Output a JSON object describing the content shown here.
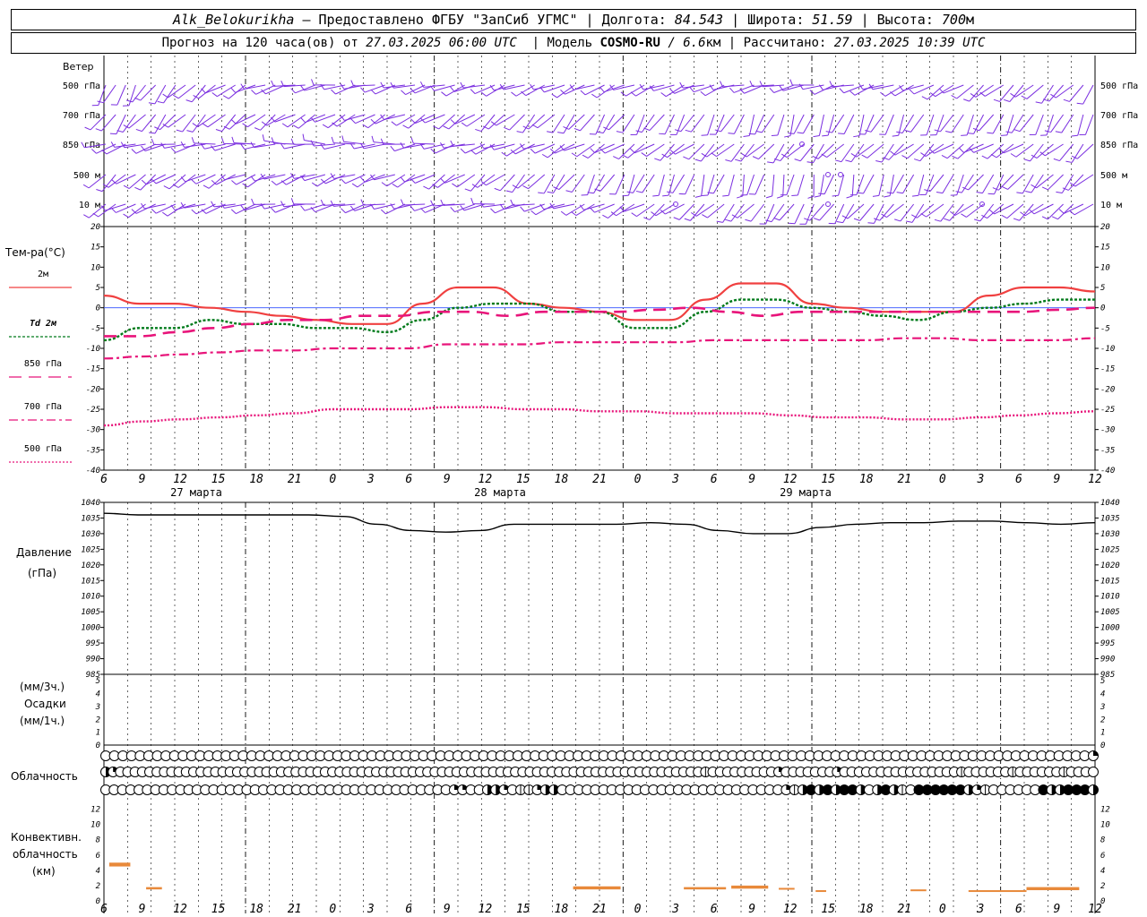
{
  "header": {
    "station": "Alk_Belokurikha",
    "provider": " – Предоставлено ФГБУ \"ЗапСиб УГМС\" ",
    "lon_label": "| Долгота: ",
    "lon_value": "84.543",
    "lat_label": " | Широта: ",
    "lat_value": "51.59",
    "alt_label": " | Высота: ",
    "alt_value": "700",
    "alt_unit": "м",
    "forecast_label": "Прогноз на 120 часа(ов) от ",
    "forecast_start": "27.03.2025 06:00 UTC",
    "model_label": "  | Модель ",
    "model_name": "COSMO-RU",
    "model_res": " / 6.6",
    "model_res_unit": "км",
    "calc_label": " | Рассчитано: ",
    "calc_time": "27.03.2025 10:39 UTC"
  },
  "colors": {
    "wind": "#7a2ee0",
    "t2m": "#f04040",
    "td2m": "#007a1a",
    "t850": "#e8147a",
    "t700": "#e8147a",
    "t500": "#e8147a",
    "zero_line": "#3050ff",
    "pressure": "#000000",
    "convective": "#e8893a"
  },
  "wind_panel": {
    "title": "Ветер",
    "levels": [
      "500 гПа",
      "700 гПа",
      "850 гПа",
      "500 м",
      "10  м"
    ]
  },
  "temp_panel": {
    "title": "Тем-ра(°C)",
    "legend": [
      {
        "key": "t2m",
        "label": "2м"
      },
      {
        "key": "td2m",
        "label": "Td  2м"
      },
      {
        "key": "t850",
        "label": "850 гПа"
      },
      {
        "key": "t700",
        "label": "700 гПа"
      },
      {
        "key": "t500",
        "label": "500 гПа"
      }
    ],
    "ticks": [
      "20",
      "15",
      "10",
      "5",
      "0",
      "-5",
      "-10",
      "-15",
      "-20",
      "-25",
      "-30",
      "-35",
      "-40"
    ]
  },
  "pressure_panel": {
    "title": "Давление",
    "unit": "(гПа)",
    "ticks": [
      "1040",
      "1035",
      "1030",
      "1025",
      "1020",
      "1015",
      "1010",
      "1005",
      "1000",
      "995",
      "990",
      "985"
    ]
  },
  "precip_panel": {
    "unit_top": "(мм/3ч.)",
    "title": "Осадки",
    "unit_bottom": "(мм/1ч.)",
    "ticks": [
      "5",
      "4",
      "3",
      "2",
      "1",
      "0"
    ]
  },
  "cloud_panel": {
    "title": "Облачность"
  },
  "conv_panel": {
    "title_line1": "Конвективн.",
    "title_line2": "облачность",
    "unit": "(км)",
    "ticks": [
      "12",
      "10",
      "8",
      "6",
      "4",
      "2",
      "0"
    ]
  },
  "x_axis": {
    "hour_labels": [
      "6",
      "9",
      "12",
      "15",
      "18",
      "21",
      "0",
      "3",
      "6",
      "9",
      "12",
      "15",
      "18",
      "21",
      "0",
      "3",
      "6",
      "9",
      "12",
      "15",
      "18",
      "21",
      "0",
      "3",
      "6",
      "9",
      "12"
    ],
    "day_labels": [
      "27 марта",
      "28 марта",
      "29 марта"
    ]
  },
  "chart_data": [
    {
      "type": "line",
      "title": "Тем-ра(°C)",
      "ylim": [
        -40,
        20
      ],
      "x_hours": [
        0,
        3,
        6,
        9,
        12,
        15,
        18,
        21,
        24,
        27,
        30,
        33,
        36,
        39,
        42,
        45,
        48,
        51,
        54,
        57,
        60,
        63,
        66,
        69,
        72,
        75,
        78
      ],
      "series": [
        {
          "name": "2м",
          "key": "t2m",
          "values": [
            3,
            1,
            1,
            0,
            -1,
            -2,
            -3,
            -4,
            -4,
            1,
            5,
            5,
            1,
            0,
            -1,
            -3,
            -3,
            2,
            6,
            6,
            1,
            0,
            -1,
            -1,
            -1,
            3,
            5,
            5,
            4
          ]
        },
        {
          "name": "Td  2м",
          "key": "td2m",
          "values": [
            -8,
            -5,
            -5,
            -3,
            -4,
            -4,
            -5,
            -5,
            -6,
            -3,
            0,
            1,
            1,
            -1,
            -1,
            -5,
            -5,
            -1,
            2,
            2,
            0,
            -1,
            -2,
            -3,
            -1,
            0,
            1,
            2,
            2
          ]
        },
        {
          "name": "850 гПа",
          "key": "t850",
          "values": [
            -7,
            -7,
            -6,
            -5,
            -4,
            -3,
            -3,
            -2,
            -2,
            -1,
            -1,
            -2,
            -1,
            -1,
            -1,
            -0.5,
            0,
            -1,
            -2,
            -1,
            -1,
            -1,
            -1,
            -1,
            -1,
            -1,
            -0.5,
            0
          ]
        },
        {
          "name": "700 гПа",
          "key": "t700",
          "values": [
            -12.5,
            -12,
            -11.5,
            -11,
            -10.5,
            -10.5,
            -10,
            -10,
            -10,
            -9,
            -9,
            -9,
            -8.5,
            -8.5,
            -8.5,
            -8.5,
            -8,
            -8,
            -8,
            -8,
            -8,
            -7.5,
            -7.5,
            -8,
            -8,
            -8,
            -7.5
          ]
        },
        {
          "name": "500 гПа",
          "key": "t500",
          "values": [
            -29,
            -28,
            -27.5,
            -27,
            -26.5,
            -26,
            -25,
            -25,
            -25,
            -24.5,
            -24.5,
            -25,
            -25,
            -25.5,
            -25.5,
            -26,
            -26,
            -26,
            -26.5,
            -27,
            -27,
            -27.5,
            -27.5,
            -27,
            -26.5,
            -26,
            -25.5
          ]
        }
      ]
    },
    {
      "type": "line",
      "title": "Давление",
      "ylim": [
        985,
        1040
      ],
      "series": [
        {
          "name": "Давление",
          "key": "pressure",
          "values": [
            1036.5,
            1036,
            1036,
            1036,
            1036,
            1036,
            1036,
            1035.5,
            1033,
            1031,
            1030.5,
            1031,
            1033,
            1033,
            1033,
            1033,
            1033.5,
            1033,
            1031,
            1030,
            1030,
            1032,
            1033,
            1033.5,
            1033.5,
            1034,
            1034,
            1033.5,
            1033,
            1033.5
          ]
        }
      ]
    },
    {
      "type": "bar",
      "title": "Осадки",
      "ylim": [
        0,
        5
      ],
      "values": []
    },
    {
      "type": "bar",
      "title": "Конвективн. облачность",
      "ylim": [
        0,
        13
      ],
      "segments": [
        {
          "start_h": 1,
          "end_h": 5,
          "base_km": 4.5,
          "top_km": 5
        },
        {
          "start_h": 8,
          "end_h": 11,
          "base_km": 1.5,
          "top_km": 1.8
        },
        {
          "start_h": 89,
          "end_h": 98,
          "base_km": 1.5,
          "top_km": 1.9
        },
        {
          "start_h": 110,
          "end_h": 118,
          "base_km": 1.5,
          "top_km": 1.8
        },
        {
          "start_h": 119,
          "end_h": 126,
          "base_km": 1.6,
          "top_km": 2
        },
        {
          "start_h": 128,
          "end_h": 131,
          "base_km": 1.5,
          "top_km": 1.7
        },
        {
          "start_h": 135,
          "end_h": 137,
          "base_km": 1.2,
          "top_km": 1.4
        },
        {
          "start_h": 153,
          "end_h": 156,
          "base_km": 1.3,
          "top_km": 1.5
        },
        {
          "start_h": 164,
          "end_h": 175,
          "base_km": 1.2,
          "top_km": 1.4
        },
        {
          "start_h": 175,
          "end_h": 185,
          "base_km": 1.4,
          "top_km": 1.8
        }
      ]
    }
  ],
  "clouds": {
    "upper": [
      0,
      0,
      0,
      0,
      0,
      0,
      0,
      0,
      0,
      0,
      0,
      0,
      0,
      0,
      0,
      0,
      0,
      0,
      0,
      0,
      0,
      0,
      0,
      0,
      0,
      0,
      0,
      0,
      0,
      0,
      0,
      0,
      0,
      0,
      0,
      0,
      0,
      0,
      0,
      0,
      0,
      0,
      0,
      0,
      0,
      0,
      0,
      0,
      0,
      0,
      0,
      0,
      0,
      0,
      0,
      0,
      0,
      0,
      0,
      0,
      0,
      0,
      0,
      0,
      0,
      0,
      0,
      0,
      0,
      0,
      0,
      0,
      0,
      0,
      0,
      0,
      0,
      0,
      0,
      0,
      0,
      0,
      0,
      0,
      0,
      0,
      0,
      0,
      0,
      0,
      0,
      0,
      0,
      0,
      0,
      0,
      0,
      0,
      0,
      0,
      0,
      0,
      0,
      0,
      0,
      0,
      0,
      0,
      0,
      0,
      0,
      0,
      0,
      0,
      0,
      2
    ],
    "middle": [
      3,
      2,
      0,
      0,
      0,
      0,
      0,
      0,
      0,
      0,
      0,
      0,
      0,
      0,
      0,
      0,
      0,
      0,
      0,
      0,
      0,
      0,
      0,
      0,
      0,
      0,
      0,
      0,
      0,
      0,
      0,
      0,
      0,
      0,
      0,
      0,
      0,
      0,
      0,
      0,
      0,
      0,
      0,
      0,
      0,
      0,
      0,
      0,
      0,
      0,
      0,
      0,
      0,
      0,
      0,
      0,
      0,
      0,
      0,
      0,
      0,
      0,
      0,
      0,
      0,
      0,
      0,
      0,
      0,
      0,
      0,
      0,
      0,
      0,
      0,
      0,
      0,
      0,
      0,
      0,
      0,
      0,
      1,
      0,
      0,
      0,
      0,
      0,
      0,
      0,
      0,
      0,
      2,
      0,
      0,
      0,
      0,
      0,
      0,
      0,
      2,
      0,
      0,
      0,
      0,
      0,
      0,
      0,
      0,
      0,
      0,
      0,
      0,
      0,
      0,
      0,
      0,
      1,
      0,
      0,
      0,
      0,
      0,
      0,
      1,
      0,
      0,
      0,
      0,
      0,
      0,
      1,
      0,
      0,
      0,
      0
    ],
    "lower": [
      0,
      0,
      0,
      0,
      0,
      0,
      0,
      0,
      0,
      0,
      0,
      0,
      0,
      0,
      0,
      0,
      0,
      0,
      0,
      0,
      0,
      0,
      0,
      0,
      0,
      0,
      0,
      0,
      0,
      0,
      0,
      0,
      0,
      0,
      0,
      0,
      0,
      0,
      0,
      0,
      0,
      0,
      2,
      2,
      0,
      0,
      3,
      3,
      2,
      0,
      1,
      1,
      2,
      3,
      3,
      0,
      0,
      0,
      0,
      0,
      0,
      0,
      0,
      0,
      0,
      0,
      0,
      0,
      0,
      0,
      0,
      0,
      0,
      0,
      0,
      0,
      0,
      0,
      0,
      0,
      0,
      0,
      2,
      1,
      3,
      4,
      3,
      4,
      3,
      4,
      4,
      3,
      0,
      3,
      4,
      3,
      1,
      0,
      4,
      4,
      4,
      4,
      4,
      4,
      3,
      2,
      1,
      0,
      0,
      0,
      0,
      0,
      0,
      4,
      3,
      3,
      4,
      4,
      4,
      3
    ]
  },
  "wind": {
    "rows": [
      {
        "dirs": [
          10,
          10,
          10,
          10,
          10,
          10,
          10,
          10,
          10,
          10,
          10,
          10,
          10,
          10,
          10,
          10,
          10,
          10,
          10,
          10,
          10,
          10,
          10,
          10,
          10,
          10,
          10,
          10,
          10,
          10,
          10,
          10,
          10,
          10,
          10,
          10,
          10,
          10,
          10,
          10,
          10,
          10,
          10,
          10,
          10,
          10,
          10,
          10,
          10,
          10,
          10,
          10,
          10,
          10,
          10,
          10,
          10,
          10,
          10,
          10,
          10,
          10,
          10,
          10,
          10,
          10,
          10,
          10,
          10,
          10,
          10,
          10,
          10,
          10,
          10,
          10,
          10,
          10,
          10,
          10,
          10,
          10,
          10,
          10,
          10,
          10,
          10,
          10,
          10,
          10,
          10,
          10,
          10,
          10,
          10,
          10,
          10,
          10,
          10,
          10,
          10,
          10,
          10,
          10,
          10,
          10,
          10,
          10,
          10,
          10,
          10,
          10,
          10,
          10,
          10,
          10,
          10,
          10,
          10,
          10,
          10,
          10,
          10,
          10,
          10,
          10,
          10,
          10,
          10,
          10,
          10,
          10,
          10
        ]
      },
      {
        "dirs": []
      },
      {
        "dirs": []
      },
      {
        "dirs": []
      },
      {
        "dirs": []
      }
    ]
  }
}
